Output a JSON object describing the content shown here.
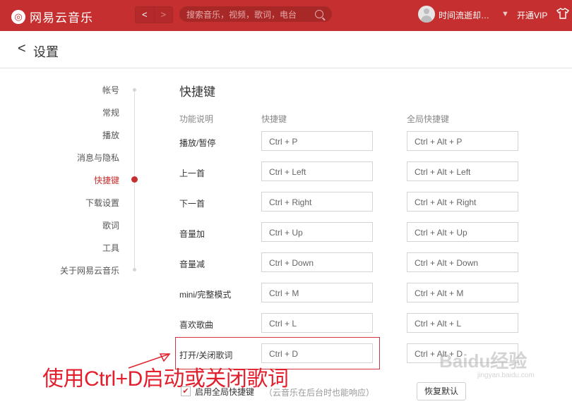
{
  "app": {
    "name": "网易云音乐",
    "logo_glyph": "◎",
    "back_glyph": "<",
    "forward_glyph": ">",
    "search_placeholder": "搜索音乐，视频，歌词，电台",
    "username": "时间流逝却…",
    "user_caret": "▼",
    "vip_label": "开通VIP",
    "accent": "#c62f2f"
  },
  "page": {
    "back_glyph": "<",
    "title": "设置"
  },
  "sidebar": {
    "items": [
      {
        "label": "帐号"
      },
      {
        "label": "常规"
      },
      {
        "label": "播放"
      },
      {
        "label": "消息与隐私"
      },
      {
        "label": "快捷键"
      },
      {
        "label": "下载设置"
      },
      {
        "label": "歌词"
      },
      {
        "label": "工具"
      },
      {
        "label": "关于网易云音乐"
      }
    ],
    "active": "快捷键"
  },
  "shortcuts": {
    "section_title": "快捷键",
    "col_function": "功能说明",
    "col_shortcut": "快捷键",
    "col_global": "全局快捷键",
    "rows": [
      {
        "label": "播放/暂停",
        "key": "Ctrl + P",
        "global": "Ctrl + Alt + P"
      },
      {
        "label": "上一首",
        "key": "Ctrl + Left",
        "global": "Ctrl + Alt + Left"
      },
      {
        "label": "下一首",
        "key": "Ctrl + Right",
        "global": "Ctrl + Alt + Right"
      },
      {
        "label": "音量加",
        "key": "Ctrl + Up",
        "global": "Ctrl + Alt + Up"
      },
      {
        "label": "音量减",
        "key": "Ctrl + Down",
        "global": "Ctrl + Alt + Down"
      },
      {
        "label": "mini/完整模式",
        "key": "Ctrl + M",
        "global": "Ctrl + Alt + M"
      },
      {
        "label": "喜欢歌曲",
        "key": "Ctrl + L",
        "global": "Ctrl + Alt + L"
      },
      {
        "label": "打开/关闭歌词",
        "key": "Ctrl + D",
        "global": "Ctrl + Alt + D"
      }
    ],
    "global_enable_label": "启用全局快捷键",
    "global_enable_hint": "（云音乐在后台时也能响应）",
    "global_enabled": true,
    "check_glyph": "✔",
    "restore_label": "恢复默认"
  },
  "annotation": {
    "caption": "使用Ctrl+D启动或关闭歌词",
    "color": "#e21f2c"
  },
  "watermark": {
    "text": "Baidu经验",
    "sub": "jingyan.baidu.com"
  }
}
